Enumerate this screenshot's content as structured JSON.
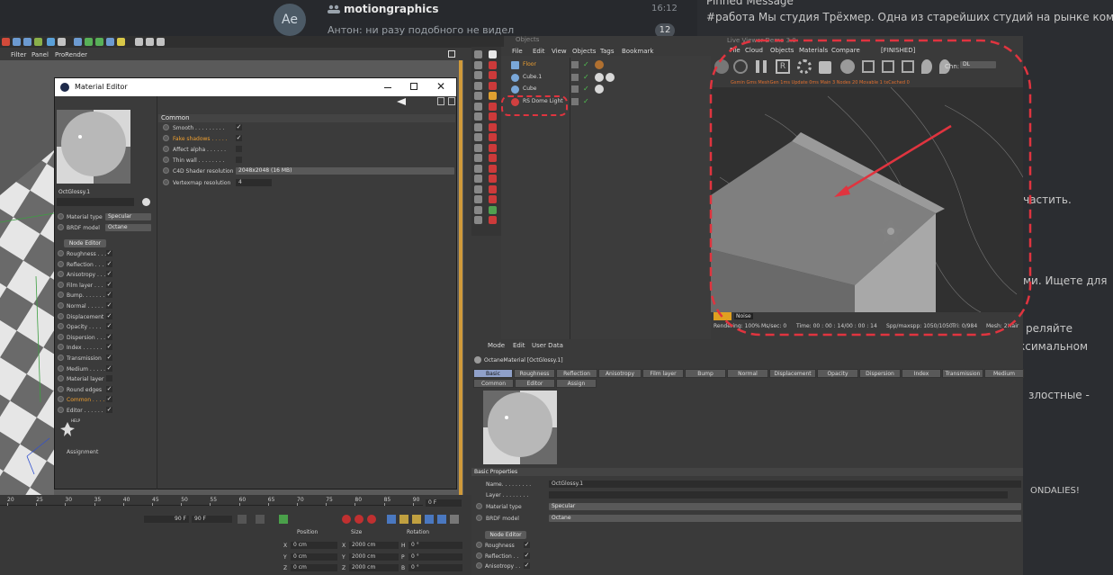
{
  "chat": {
    "title": "motiongraphics",
    "avatar": "Ae",
    "time": "16:12",
    "badge": "12",
    "preview": "Антон: ни разу подобного не видел",
    "right_lines": [
      "Pinned Message",
      "#работа Мы студия Трёхмер. Одна из старейших студий на рынке компь",
      "участить.",
      "ми. Ищете для",
      "реляйте",
      "ксимальном",
      "злостные -",
      "ONDALIES!"
    ]
  },
  "app": {
    "menu": [
      "Filter",
      "Panel",
      "ProRender"
    ]
  },
  "material_editor": {
    "title": "Material Editor",
    "material_name": "OctGlossy.1",
    "material_type_label": "Material type",
    "material_type_value": "Specular",
    "brdf_label": "BRDF model",
    "brdf_value": "Octane",
    "node_editor_button": "Node Editor",
    "channels": [
      {
        "label": "Roughness . . .",
        "checked": "✓"
      },
      {
        "label": "Reflection . . .",
        "checked": "✓"
      },
      {
        "label": "Anisotropy . . .",
        "checked": "✓"
      },
      {
        "label": "Film layer . . .",
        "checked": "✓"
      },
      {
        "label": "Bump. . . . . . .",
        "checked": "✓"
      },
      {
        "label": "Normal . . . . .",
        "checked": "✓"
      },
      {
        "label": "Displacement",
        "checked": "✓"
      },
      {
        "label": "Opacity . . . .",
        "checked": "✓"
      },
      {
        "label": "Dispersion . . .",
        "checked": "✓"
      },
      {
        "label": "Index . . . . . .",
        "checked": "✓"
      },
      {
        "label": "Transmission",
        "checked": "✓"
      },
      {
        "label": "Medium . . . . .",
        "checked": "✓"
      },
      {
        "label": "Material layer",
        "checked": ""
      },
      {
        "label": "Round edges",
        "checked": "✓"
      },
      {
        "label": "Common . . . .",
        "checked": "✓"
      },
      {
        "label": "Editor . . . . . .",
        "checked": "✓"
      }
    ],
    "assignment_label": "Assignment",
    "help_label": "HELP",
    "common_header": "Common",
    "common": [
      {
        "label": "Smooth . . . . . . . . .",
        "checked": "✓"
      },
      {
        "label": "Fake shadows . . . . .",
        "checked": "✓"
      },
      {
        "label": "Affect alpha . . . . . .",
        "checked": ""
      },
      {
        "label": "Thin wall . . . . . . . .",
        "checked": ""
      }
    ],
    "shader_res_label": "C4D Shader resolution",
    "shader_res_value": "2048x2048 (16 MB)",
    "vertexmap_label": "Vertexmap resolution",
    "vertexmap_value": "4"
  },
  "object_manager": {
    "title": "Objects",
    "menu": [
      "File",
      "Edit",
      "View",
      "Objects",
      "Tags",
      "Bookmark"
    ],
    "objects": [
      "Floor",
      "Cube.1",
      "Cube",
      "RS Dome Light"
    ]
  },
  "render_window": {
    "title": "Live Viewer Demo 3.0",
    "menu": [
      "File",
      "Cloud",
      "Objects",
      "Materials",
      "Compare"
    ],
    "status": "[FINISHED]",
    "chn_label": "Chn:",
    "chn_value": "DL",
    "stats_top": "Gsmin Gms MeshGen 1ms Update 0ms Main 3 Nodes 20 Movable 1 txCached 0",
    "stats_bottom_prefix": "Rendering: 100%",
    "ms_sec": "Ms/sec: 0",
    "time": "Time: 00 : 00 : 14/00 : 00 : 14",
    "spp": "Spp/maxspp: 1050/1050",
    "tri": "Tri: 0/984",
    "mesh": "Mesh: 2",
    "hair": "Hair",
    "noise_label": "Noise"
  },
  "attributes": {
    "menu": [
      "Mode",
      "Edit",
      "User Data"
    ],
    "material_title": "OctaneMaterial [OctGlossy.1]",
    "tabs_row1": [
      "Basic",
      "Roughness",
      "Reflection",
      "Anisotropy",
      "Film layer",
      "Bump",
      "Normal",
      "Displacement",
      "Opacity",
      "Dispersion",
      "Index",
      "Transmission",
      "Medium"
    ],
    "tabs_row2": [
      "Common",
      "Editor",
      "Assign"
    ],
    "section": "Basic Properties",
    "name_label": "Name. . . . . . . . .",
    "name_value": "OctGlossy.1",
    "layer_label": "Layer . . . . . . . .",
    "material_type_label": "Material type",
    "material_type_value": "Specular",
    "brdf_label": "BRDF model",
    "brdf_value": "Octane",
    "node_editor_button": "Node Editor",
    "channels": [
      {
        "label": "Roughness",
        "checked": "✓"
      },
      {
        "label": "Reflection . .",
        "checked": "✓"
      },
      {
        "label": "Anisotropy . .",
        "checked": "✓"
      }
    ]
  },
  "timeline": {
    "ticks": [
      "20",
      "25",
      "30",
      "35",
      "40",
      "45",
      "50",
      "55",
      "60",
      "65",
      "70",
      "75",
      "80",
      "85",
      "90"
    ],
    "current_frame": "0 F",
    "end_frame": "90 F",
    "end_frame2": "90 F",
    "headers": [
      "Position",
      "Size",
      "Rotation"
    ],
    "rows": [
      {
        "axis": "X",
        "pos": "0 cm",
        "size_axis": "X",
        "size": "2000 cm",
        "rot_axis": "H",
        "rot": "0 °"
      },
      {
        "axis": "Y",
        "pos": "0 cm",
        "size_axis": "Y",
        "size": "2000 cm",
        "rot_axis": "P",
        "rot": "0 °"
      },
      {
        "axis": "Z",
        "pos": "0 cm",
        "size_axis": "Z",
        "size": "2000 cm",
        "rot_axis": "B",
        "rot": "0 °"
      }
    ]
  },
  "colors": {
    "highlight_red": "#e0343f",
    "orange_text": "#f0a030",
    "active_tab": "#8fa0c9"
  }
}
